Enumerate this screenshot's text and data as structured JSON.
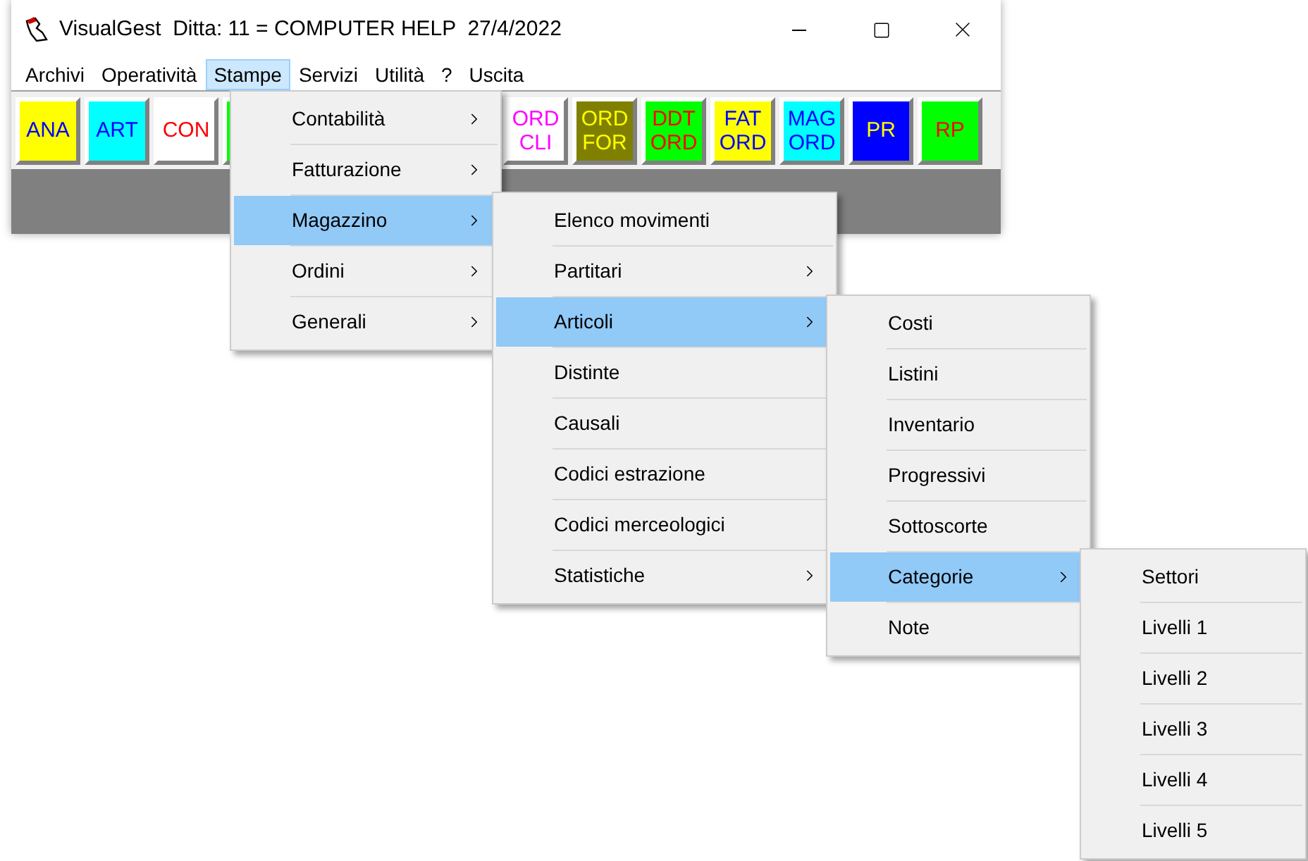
{
  "window": {
    "title": "VisualGest  Ditta: 11 = COMPUTER HELP  27/4/2022"
  },
  "menubar": [
    {
      "label": "Archivi",
      "selected": false
    },
    {
      "label": "Operatività",
      "selected": false
    },
    {
      "label": "Stampe",
      "selected": true
    },
    {
      "label": "Servizi",
      "selected": false
    },
    {
      "label": "Utilità",
      "selected": false
    },
    {
      "label": "?",
      "selected": false
    },
    {
      "label": "Uscita",
      "selected": false
    }
  ],
  "toolbar": [
    {
      "color": "#ffff00",
      "label": {
        "lines": [
          "ANA"
        ],
        "color": "#0000ff"
      }
    },
    {
      "color": "#00ffff",
      "label": {
        "lines": [
          "ART"
        ],
        "color": "#0000ff"
      }
    },
    {
      "color": "#ffffff",
      "label": {
        "lines": [
          "CON"
        ],
        "color": "#ff0000"
      }
    },
    {
      "color": "#00ff00"
    },
    {
      "color": "#ffffff",
      "label": {
        "lines": [
          "ORD",
          "CLI"
        ],
        "color": "#ff00ff"
      }
    },
    {
      "color": "#808000",
      "label": {
        "lines": [
          "ORD",
          "FOR"
        ],
        "color": "#ffff00"
      }
    },
    {
      "color": "#00ff00",
      "label": {
        "lines": [
          "DDT",
          "ORD"
        ],
        "color": "#ff0000"
      }
    },
    {
      "color": "#ffff00",
      "label": {
        "lines": [
          "FAT",
          "ORD"
        ],
        "color": "#0000ff"
      }
    },
    {
      "color": "#00ffff",
      "label": {
        "lines": [
          "MAG",
          "ORD"
        ],
        "color": "#0000ff"
      }
    },
    {
      "color": "#0000ff",
      "label": {
        "lines": [
          "PR"
        ],
        "color": "#ffff00"
      }
    },
    {
      "color": "#00ff00",
      "label": {
        "lines": [
          "RP"
        ],
        "color": "#ff0000"
      }
    }
  ],
  "open_menus": [
    {
      "items": [
        {
          "label": "Contabilità",
          "submenu": true,
          "selected": false
        },
        {
          "label": "Fatturazione",
          "submenu": true,
          "selected": false
        },
        {
          "label": "Magazzino",
          "submenu": true,
          "selected": true
        },
        {
          "label": "Ordini",
          "submenu": true,
          "selected": false
        },
        {
          "label": "Generali",
          "submenu": true,
          "selected": false
        }
      ]
    },
    {
      "items": [
        {
          "label": "Elenco movimenti",
          "submenu": false,
          "selected": false
        },
        {
          "label": "Partitari",
          "submenu": true,
          "selected": false
        },
        {
          "label": "Articoli",
          "submenu": true,
          "selected": true
        },
        {
          "label": "Distinte",
          "submenu": false,
          "selected": false
        },
        {
          "label": "Causali",
          "submenu": false,
          "selected": false
        },
        {
          "label": "Codici estrazione",
          "submenu": false,
          "selected": false
        },
        {
          "label": "Codici merceologici",
          "submenu": false,
          "selected": false
        },
        {
          "label": "Statistiche",
          "submenu": true,
          "selected": false
        }
      ]
    },
    {
      "items": [
        {
          "label": "Costi",
          "submenu": false,
          "selected": false
        },
        {
          "label": "Listini",
          "submenu": false,
          "selected": false
        },
        {
          "label": "Inventario",
          "submenu": false,
          "selected": false
        },
        {
          "label": "Progressivi",
          "submenu": false,
          "selected": false
        },
        {
          "label": "Sottoscorte",
          "submenu": false,
          "selected": false
        },
        {
          "label": "Categorie",
          "submenu": true,
          "selected": true
        },
        {
          "label": "Note",
          "submenu": false,
          "selected": false
        }
      ]
    },
    {
      "items": [
        {
          "label": "Settori",
          "submenu": false,
          "selected": false
        },
        {
          "label": "Livelli 1",
          "submenu": false,
          "selected": false
        },
        {
          "label": "Livelli 2",
          "submenu": false,
          "selected": false
        },
        {
          "label": "Livelli 3",
          "submenu": false,
          "selected": false
        },
        {
          "label": "Livelli 4",
          "submenu": false,
          "selected": false
        },
        {
          "label": "Livelli 5",
          "submenu": false,
          "selected": false
        }
      ]
    }
  ]
}
